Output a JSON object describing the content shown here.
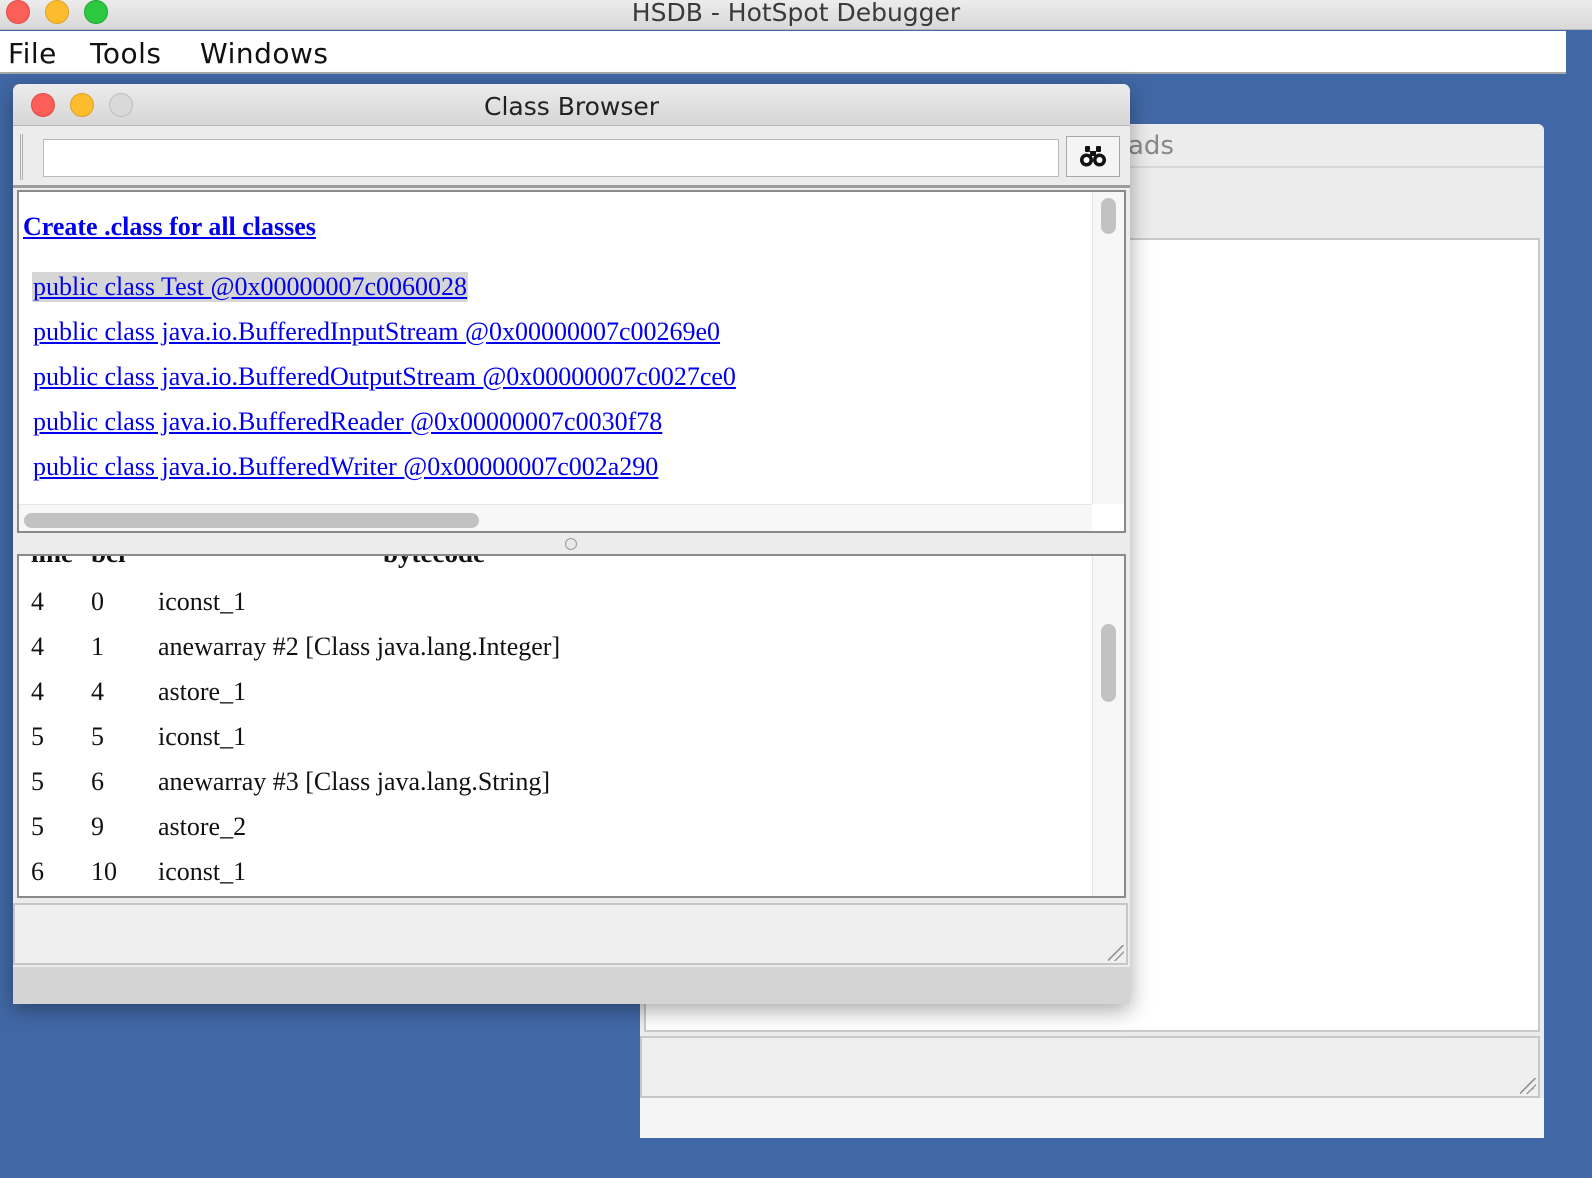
{
  "app": {
    "title": "HSDB - HotSpot Debugger",
    "menu": [
      "File",
      "Tools",
      "Windows"
    ]
  },
  "background_window": {
    "tab_label_partial": "ads"
  },
  "class_browser": {
    "title": "Class Browser",
    "search": {
      "value": "",
      "placeholder": ""
    },
    "find_icon": "binoculars-icon",
    "create_link": "Create .class for all classes",
    "classes": [
      "public class Test @0x00000007c0060028",
      "public class java.io.BufferedInputStream @0x00000007c00269e0",
      "public class java.io.BufferedOutputStream @0x00000007c0027ce0",
      "public class java.io.BufferedReader @0x00000007c0030f78",
      "public class java.io.BufferedWriter @0x00000007c002a290"
    ],
    "selected_class_index": 0,
    "bytecode": {
      "headers": [
        "line",
        "bci",
        "bytecode"
      ],
      "rows": [
        [
          "4",
          "0",
          "iconst_1"
        ],
        [
          "4",
          "1",
          "anewarray #2 [Class java.lang.Integer]"
        ],
        [
          "4",
          "4",
          "astore_1"
        ],
        [
          "5",
          "5",
          "iconst_1"
        ],
        [
          "5",
          "6",
          "anewarray #3 [Class java.lang.String]"
        ],
        [
          "5",
          "9",
          "astore_2"
        ],
        [
          "6",
          "10",
          "iconst_1"
        ]
      ]
    }
  },
  "colors": {
    "desktop": "#4168a6",
    "link": "#0000ee",
    "close": "#fc5f57",
    "minimize": "#fdbc2e",
    "zoom": "#2bc840"
  }
}
